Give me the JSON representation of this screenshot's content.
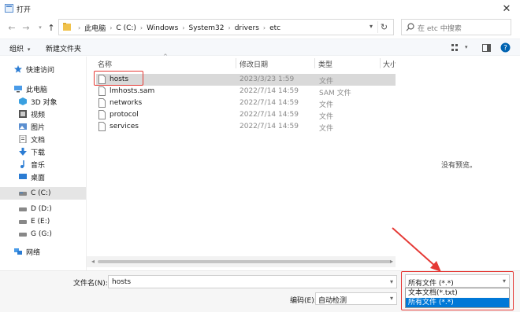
{
  "window": {
    "title": "打开"
  },
  "address": {
    "crumbs": [
      "此电脑",
      "C (C:)",
      "Windows",
      "System32",
      "drivers",
      "etc"
    ]
  },
  "search": {
    "placeholder": "在 etc 中搜索"
  },
  "toolbar": {
    "organize": "组织",
    "new_folder": "新建文件夹"
  },
  "sidebar": {
    "items": [
      {
        "label": "快速访问",
        "icon": "star-icon"
      },
      {
        "label": "此电脑",
        "icon": "computer-icon"
      },
      {
        "label": "3D 对象",
        "icon": "cube-icon"
      },
      {
        "label": "视频",
        "icon": "video-icon"
      },
      {
        "label": "图片",
        "icon": "picture-icon"
      },
      {
        "label": "文档",
        "icon": "document-icon"
      },
      {
        "label": "下载",
        "icon": "download-icon"
      },
      {
        "label": "音乐",
        "icon": "music-icon"
      },
      {
        "label": "桌面",
        "icon": "desktop-icon"
      },
      {
        "label": "C (C:)",
        "icon": "drive-icon",
        "selected": true
      },
      {
        "label": "D (D:)",
        "icon": "drive-icon"
      },
      {
        "label": "E (E:)",
        "icon": "drive-icon"
      },
      {
        "label": "G (G:)",
        "icon": "drive-icon"
      },
      {
        "label": "网络",
        "icon": "network-icon"
      }
    ]
  },
  "columns": {
    "name": "名称",
    "modified": "修改日期",
    "type": "类型",
    "size": "大小"
  },
  "files": [
    {
      "name": "hosts",
      "modified": "2023/3/23 1:59",
      "type": "文件",
      "selected": true
    },
    {
      "name": "lmhosts.sam",
      "modified": "2022/7/14 14:59",
      "type": "SAM 文件"
    },
    {
      "name": "networks",
      "modified": "2022/7/14 14:59",
      "type": "文件"
    },
    {
      "name": "protocol",
      "modified": "2022/7/14 14:59",
      "type": "文件"
    },
    {
      "name": "services",
      "modified": "2022/7/14 14:59",
      "type": "文件"
    }
  ],
  "preview": {
    "text": "没有预览。"
  },
  "bottom": {
    "filename_label": "文件名(N):",
    "filename_value": "hosts",
    "encoding_label": "编码(E):",
    "encoding_value": "自动检测"
  },
  "filetype": {
    "selected": "所有文件 (*.*)",
    "options": [
      "文本文档(*.txt)",
      "所有文件 (*.*)"
    ]
  },
  "colors": {
    "accent": "#0078d7",
    "annotation": "#e53935",
    "help": "#0063b1"
  }
}
